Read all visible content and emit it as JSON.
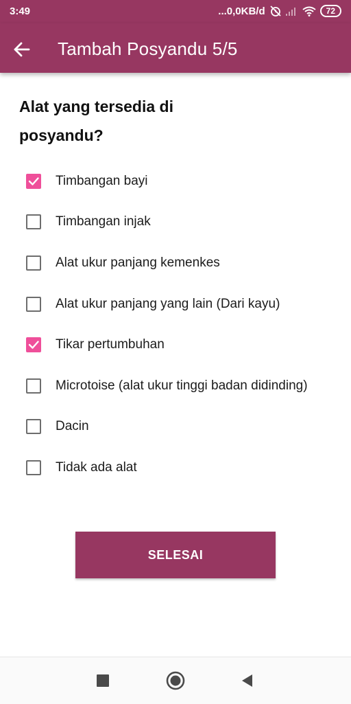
{
  "status_bar": {
    "time": "3:49",
    "network_speed": "...0,0KB/d",
    "battery": "72",
    "icons": [
      "alarm-off-icon",
      "signal-icon",
      "wifi-icon",
      "battery-icon"
    ]
  },
  "app_bar": {
    "title": "Tambah Posyandu 5/5",
    "back_icon": "arrow-left-icon"
  },
  "question": "Alat yang tersedia di posyandu?",
  "options": [
    {
      "label": "Timbangan bayi",
      "checked": true
    },
    {
      "label": "Timbangan injak",
      "checked": false
    },
    {
      "label": "Alat ukur panjang kemenkes",
      "checked": false
    },
    {
      "label": "Alat ukur panjang yang lain (Dari kayu)",
      "checked": false
    },
    {
      "label": "Tikar pertumbuhan",
      "checked": true
    },
    {
      "label": "Microtoise (alat ukur tinggi badan didinding)",
      "checked": false
    },
    {
      "label": "Dacin",
      "checked": false
    },
    {
      "label": "Tidak ada alat",
      "checked": false
    }
  ],
  "submit_label": "SELESAI",
  "nav_bar": {
    "icons": [
      "recents-square-icon",
      "home-circle-icon",
      "back-triangle-icon"
    ]
  },
  "colors": {
    "primary": "#973761",
    "checkbox_checked": "#EF4F9A",
    "checkbox_unchecked": "#6D6D6D"
  }
}
